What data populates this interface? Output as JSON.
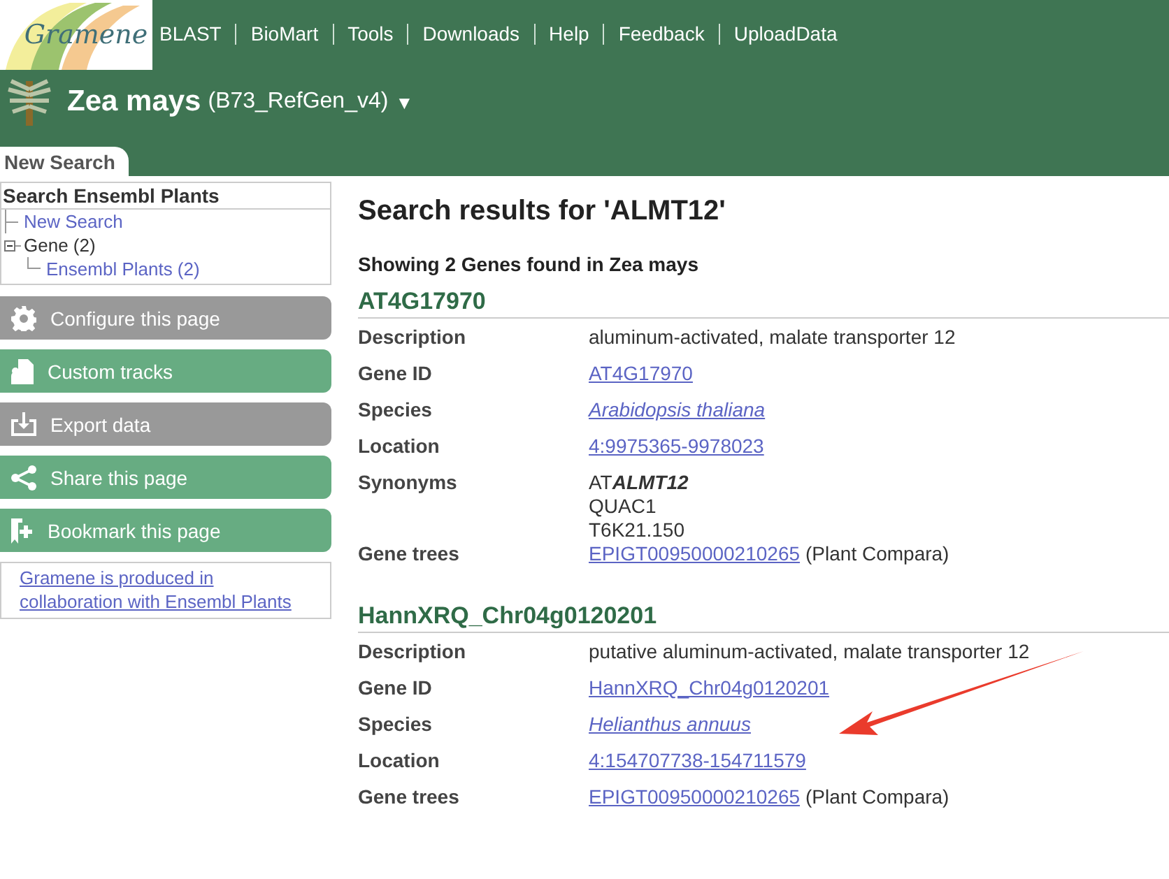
{
  "logo": {
    "text": "Gramene"
  },
  "nav": [
    "BLAST",
    "BioMart",
    "Tools",
    "Downloads",
    "Help",
    "Feedback",
    "UploadData"
  ],
  "species": {
    "name": "Zea mays",
    "assembly": "(B73_RefGen_v4)",
    "caret": "▼"
  },
  "tabs": [
    {
      "label": "New Search",
      "selected": true
    }
  ],
  "sidebar": {
    "title": "Search Ensembl Plants",
    "tree": [
      {
        "label": "New Search",
        "link": true
      },
      {
        "label": "Gene (2)",
        "link": false,
        "expanded": true,
        "children": [
          {
            "label": "Ensembl Plants (2)",
            "link": true
          }
        ]
      }
    ],
    "buttons": [
      {
        "label": "Configure this page",
        "disabled": true
      },
      {
        "label": "Custom tracks",
        "disabled": false
      },
      {
        "label": "Export data",
        "disabled": true
      },
      {
        "label": "Share this page",
        "disabled": false
      },
      {
        "label": "Bookmark this page",
        "disabled": false
      }
    ],
    "footer_link": "Gramene is produced in collaboration with Ensembl Plants"
  },
  "title": "Search results for 'ALMT12'",
  "summary": "Showing 2 Genes found in Zea mays",
  "genes": [
    {
      "id": "AT4G17970",
      "rows": [
        {
          "label": "Description",
          "lines": [
            [
              {
                "kind": "plain",
                "text": "aluminum-activated, malate transporter 12"
              }
            ]
          ]
        },
        {
          "label": "Gene ID",
          "lines": [
            [
              {
                "kind": "link",
                "text": "AT4G17970"
              }
            ]
          ]
        },
        {
          "label": "Species",
          "lines": [
            [
              {
                "kind": "species",
                "text": "Arabidopsis thaliana"
              }
            ]
          ]
        },
        {
          "label": "Location",
          "lines": [
            [
              {
                "kind": "link",
                "text": "4:9975365-9978023"
              }
            ]
          ]
        },
        {
          "label": "Synonyms",
          "lines": [
            [
              {
                "kind": "synonym",
                "text": "AT**ALMT12**"
              }
            ],
            [
              {
                "kind": "plain",
                "text": "QUAC1"
              }
            ],
            [
              {
                "kind": "plain",
                "text": "T6K21.150"
              }
            ]
          ]
        },
        {
          "label": "Gene trees",
          "lines": [
            [
              {
                "kind": "link",
                "text": "EPIGT00950000210265"
              },
              {
                "kind": "plain",
                "text": "(Plant Compara)"
              }
            ]
          ]
        }
      ]
    },
    {
      "id": "HannXRQ_Chr04g0120201",
      "rows": [
        {
          "label": "Description",
          "lines": [
            [
              {
                "kind": "plain",
                "text": "putative aluminum-activated, malate transporter 12"
              }
            ]
          ]
        },
        {
          "label": "Gene ID",
          "lines": [
            [
              {
                "kind": "link",
                "text": "HannXRQ_Chr04g0120201"
              }
            ]
          ]
        },
        {
          "label": "Species",
          "lines": [
            [
              {
                "kind": "species",
                "text": "Helianthus annuus"
              }
            ]
          ]
        },
        {
          "label": "Location",
          "lines": [
            [
              {
                "kind": "link",
                "text": "4:154707738-154711579"
              }
            ]
          ]
        },
        {
          "label": "Gene trees",
          "lines": [
            [
              {
                "kind": "link",
                "text": "EPIGT00950000210265"
              },
              {
                "kind": "plain",
                "text": "(Plant Compara)"
              }
            ]
          ]
        }
      ]
    }
  ]
}
